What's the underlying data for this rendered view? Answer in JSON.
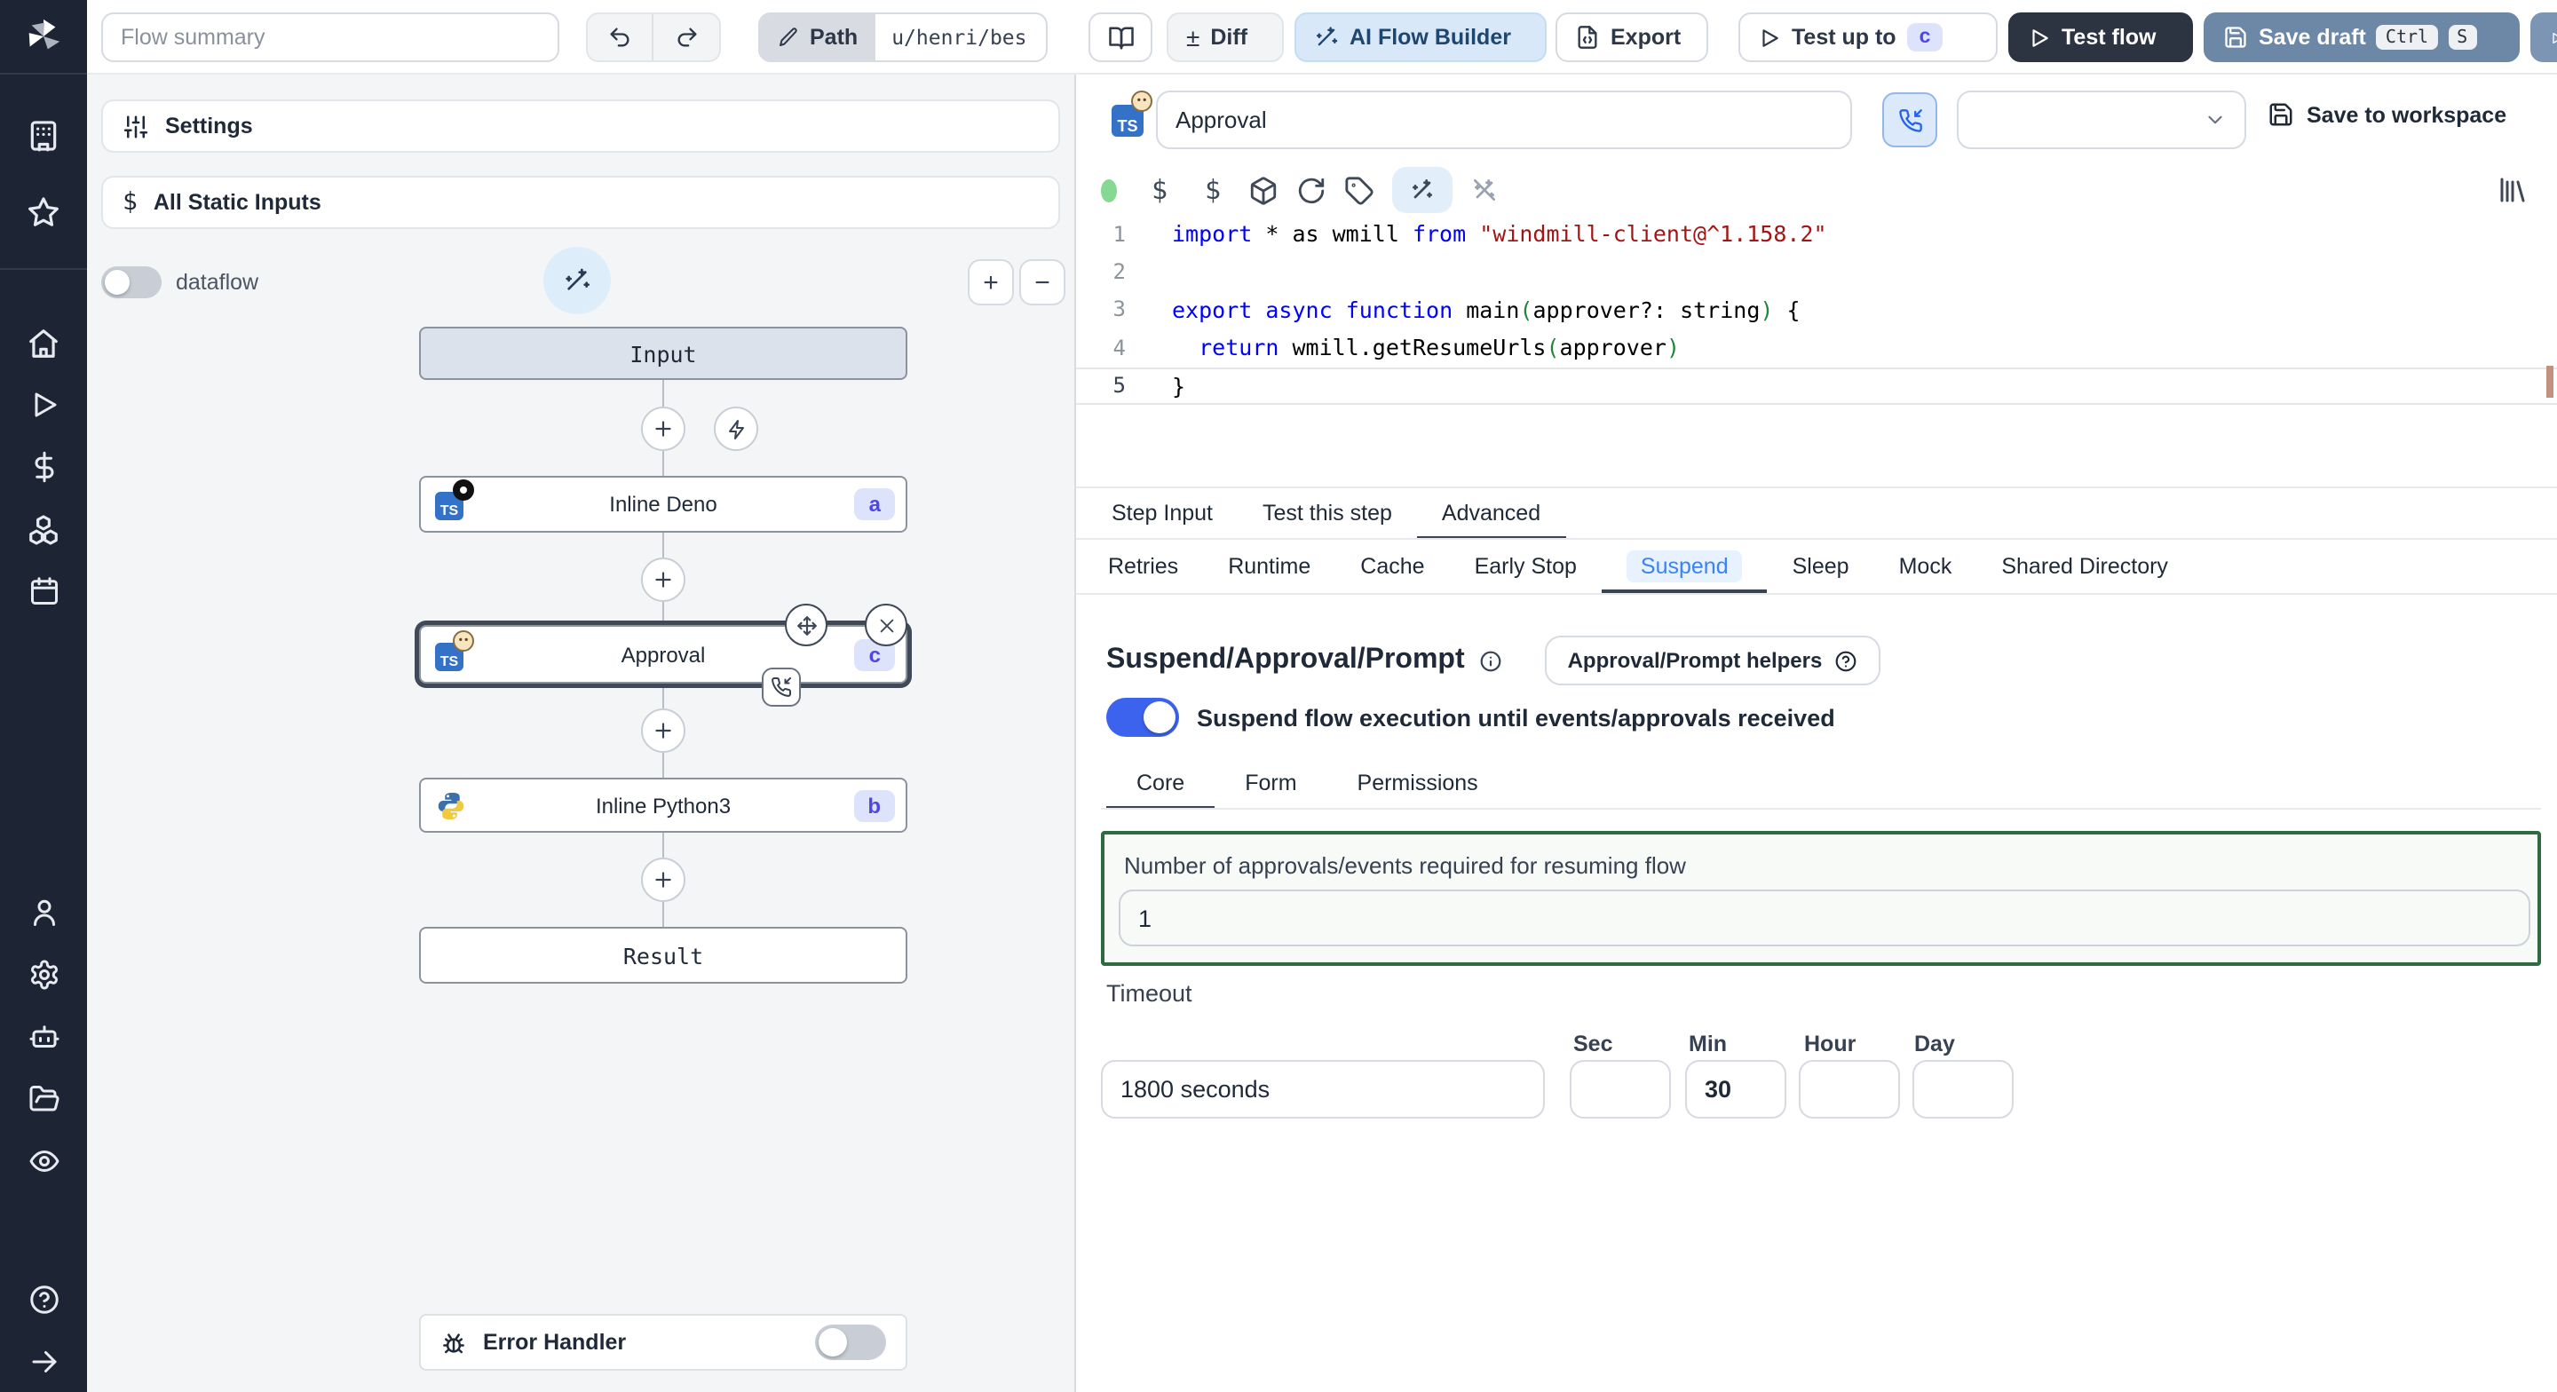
{
  "topbar": {
    "flow_summary_placeholder": "Flow summary",
    "path_label": "Path",
    "path_value": "u/henri/bes",
    "diff_label": "Diff",
    "ai_flow_builder_label": "AI Flow Builder",
    "export_label": "Export",
    "test_up_to_label": "Test up to",
    "test_up_to_badge": "c",
    "test_flow_label": "Test flow",
    "save_draft_label": "Save draft",
    "save_draft_kbd_1": "Ctrl",
    "save_draft_kbd_2": "S"
  },
  "left_panel": {
    "settings_label": "Settings",
    "settings_icon_prefix": "$",
    "static_inputs_label": "All Static Inputs",
    "dataflow_label": "dataflow",
    "zoom_in": "+",
    "zoom_out": "−",
    "graph": {
      "input_label": "Input",
      "deno_node": {
        "label": "Inline Deno",
        "badge": "a"
      },
      "approval_node": {
        "label": "Approval",
        "badge": "c"
      },
      "python_node": {
        "label": "Inline Python3",
        "badge": "b"
      },
      "result_label": "Result"
    },
    "error_handler_label": "Error Handler"
  },
  "step_editor": {
    "name_value": "Approval",
    "save_to_workspace_label": "Save to workspace",
    "code": {
      "line_numbers": [
        "1",
        "2",
        "3",
        "4",
        "5"
      ],
      "active_line": 5,
      "lines": [
        [
          {
            "t": "import",
            "c": "kw"
          },
          {
            "t": " * as wmill ",
            "c": "pl"
          },
          {
            "t": "from",
            "c": "kw"
          },
          {
            "t": " ",
            "c": "pl"
          },
          {
            "t": "\"windmill-client@^1.158.2\"",
            "c": "str"
          }
        ],
        [],
        [
          {
            "t": "export",
            "c": "kw"
          },
          {
            "t": " ",
            "c": "pl"
          },
          {
            "t": "async",
            "c": "kw"
          },
          {
            "t": " ",
            "c": "pl"
          },
          {
            "t": "function",
            "c": "kw"
          },
          {
            "t": " main",
            "c": "pl"
          },
          {
            "t": "(",
            "c": "par"
          },
          {
            "t": "approver?: string",
            "c": "pl"
          },
          {
            "t": ")",
            "c": "par"
          },
          {
            "t": " {",
            "c": "pl"
          }
        ],
        [
          {
            "t": "  ",
            "c": "pl"
          },
          {
            "t": "return",
            "c": "kw"
          },
          {
            "t": " wmill.getResumeUrls",
            "c": "pl"
          },
          {
            "t": "(",
            "c": "par"
          },
          {
            "t": "approver",
            "c": "pl"
          },
          {
            "t": ")",
            "c": "par"
          }
        ],
        [
          {
            "t": "}",
            "c": "pl"
          }
        ]
      ]
    },
    "tabs": [
      "Step Input",
      "Test this step",
      "Advanced"
    ],
    "active_tab": "Advanced",
    "advanced_tabs": [
      "Retries",
      "Runtime",
      "Cache",
      "Early Stop",
      "Suspend",
      "Sleep",
      "Mock",
      "Shared Directory"
    ],
    "active_advanced_tab": "Suspend",
    "suspend": {
      "heading": "Suspend/Approval/Prompt",
      "helpers_button_label": "Approval/Prompt helpers",
      "toggle_label": "Suspend flow execution until events/approvals received",
      "toggle_on": true,
      "tabs": [
        "Core",
        "Form",
        "Permissions"
      ],
      "active_tab": "Core",
      "approvals_label": "Number of approvals/events required for resuming flow",
      "approvals_value": "1",
      "timeout_label": "Timeout",
      "timeout_value": "1800 seconds",
      "unit_labels": [
        "Sec",
        "Min",
        "Hour",
        "Day"
      ],
      "unit_values": [
        "",
        "30",
        "",
        ""
      ]
    }
  },
  "colors": {
    "rail_bg": "#1d2433",
    "accent_toggle_blue": "#3b63ee",
    "suspend_tab_blue": "#3b82f6",
    "approvals_box_green": "#2d6a3f",
    "save_draft_steel": "#6d87a6",
    "test_flow_dark": "#2b3440",
    "badge_bg": "#dee3fc",
    "badge_text": "#4f46e5",
    "status_dot_green": "#86d993"
  }
}
